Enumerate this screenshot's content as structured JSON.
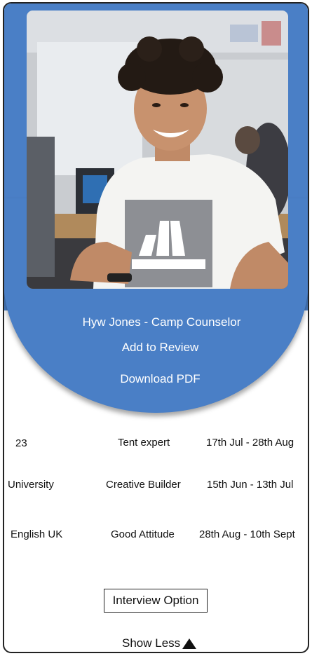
{
  "profile": {
    "name": "Hyw Jones",
    "separator": " - ",
    "role": "Camp Counselor",
    "photo_alt": "candidate-photo"
  },
  "actions": {
    "add_to_review": "Add to Review",
    "download_pdf": "Download PDF",
    "interview_option": "Interview Option",
    "show_less": "Show Less"
  },
  "details": {
    "rows": [
      [
        "23",
        "Tent expert",
        "17th Jul - 28th Aug"
      ],
      [
        "University",
        "Creative Builder",
        "15th Jun - 13th Jul"
      ],
      [
        "English UK",
        "Good Attitude",
        "28th Aug - 10th Sept"
      ]
    ]
  },
  "colors": {
    "accent": "#4a7fc6",
    "text": "#111111",
    "border": "#222222"
  },
  "icons": {
    "show_less": "triangle-up-icon"
  }
}
